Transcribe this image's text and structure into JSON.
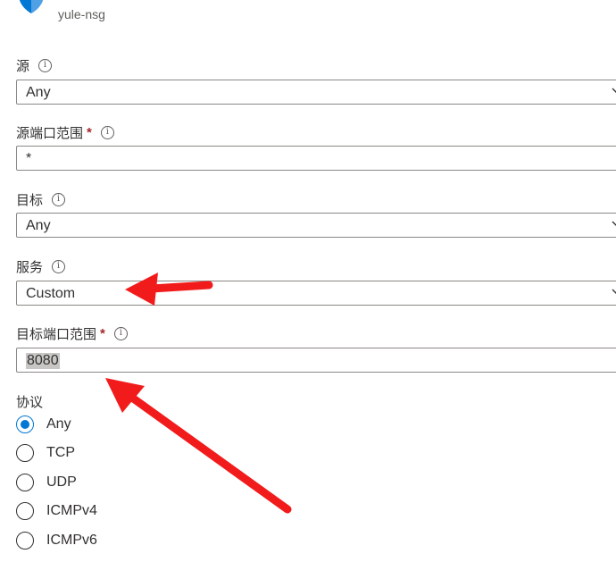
{
  "header": {
    "resource_name": "yule-nsg",
    "icon": "shield-icon"
  },
  "form": {
    "source": {
      "label": "源",
      "value": "Any"
    },
    "source_port_range": {
      "label": "源端口范围",
      "required_mark": "*",
      "value": "*"
    },
    "destination": {
      "label": "目标",
      "value": "Any"
    },
    "service": {
      "label": "服务",
      "value": "Custom"
    },
    "destination_port_range": {
      "label": "目标端口范围",
      "required_mark": "*",
      "value": "8080"
    },
    "protocol": {
      "label": "协议",
      "selected": "Any",
      "options": [
        "Any",
        "TCP",
        "UDP",
        "ICMPv4",
        "ICMPv6"
      ]
    },
    "info_glyph": "i"
  },
  "colors": {
    "accent": "#0078d4",
    "required": "#a4262c",
    "annotation_arrow": "#f21b1b"
  }
}
